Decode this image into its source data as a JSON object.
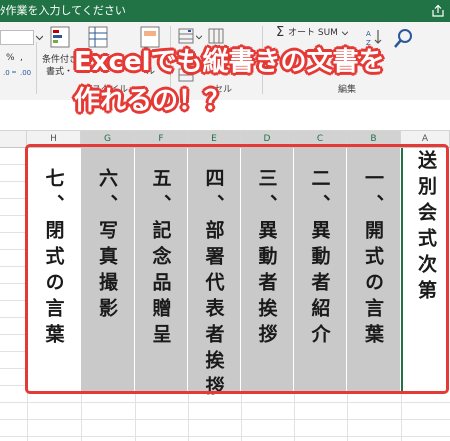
{
  "app": {
    "accent": "#217346"
  },
  "titlebar": {
    "search_text": "ﾀ作業を入力してください",
    "share_icon": "share-icon"
  },
  "ribbon": {
    "conditional_format_label_1": "条件付き",
    "conditional_format_label_2": "書式・",
    "style_group": "スタイル",
    "cell_group": "セル",
    "autosum_label": "オート SUM",
    "edit_group": "編集",
    "percent_symbol": "%",
    "comma_symbol": ",",
    "cell_style_fragment": "ル",
    "fill_fragment": "・"
  },
  "columns": [
    {
      "letter": "H",
      "text": "七、閉式の言葉",
      "shade": "white"
    },
    {
      "letter": "G",
      "text": "六、写真撮影",
      "shade": "gray"
    },
    {
      "letter": "F",
      "text": "五、記念品贈呈",
      "shade": "gray"
    },
    {
      "letter": "E",
      "text": "四、部署代表者挨拶",
      "shade": "gray"
    },
    {
      "letter": "D",
      "text": "三、異動者挨拶",
      "shade": "gray"
    },
    {
      "letter": "C",
      "text": "二、異動者紹介",
      "shade": "gray"
    },
    {
      "letter": "B",
      "text": "一、開式の言葉",
      "shade": "gray"
    },
    {
      "letter": "A",
      "text": "送別会式次第",
      "shade": "white"
    }
  ],
  "banner": {
    "line1": "Excelでも縦書きの文書を",
    "line2": "作れるの！？"
  },
  "colors": {
    "highlight": "#e53935",
    "selected_fill": "#c9c9c9",
    "banner_text": "#ffffff"
  }
}
